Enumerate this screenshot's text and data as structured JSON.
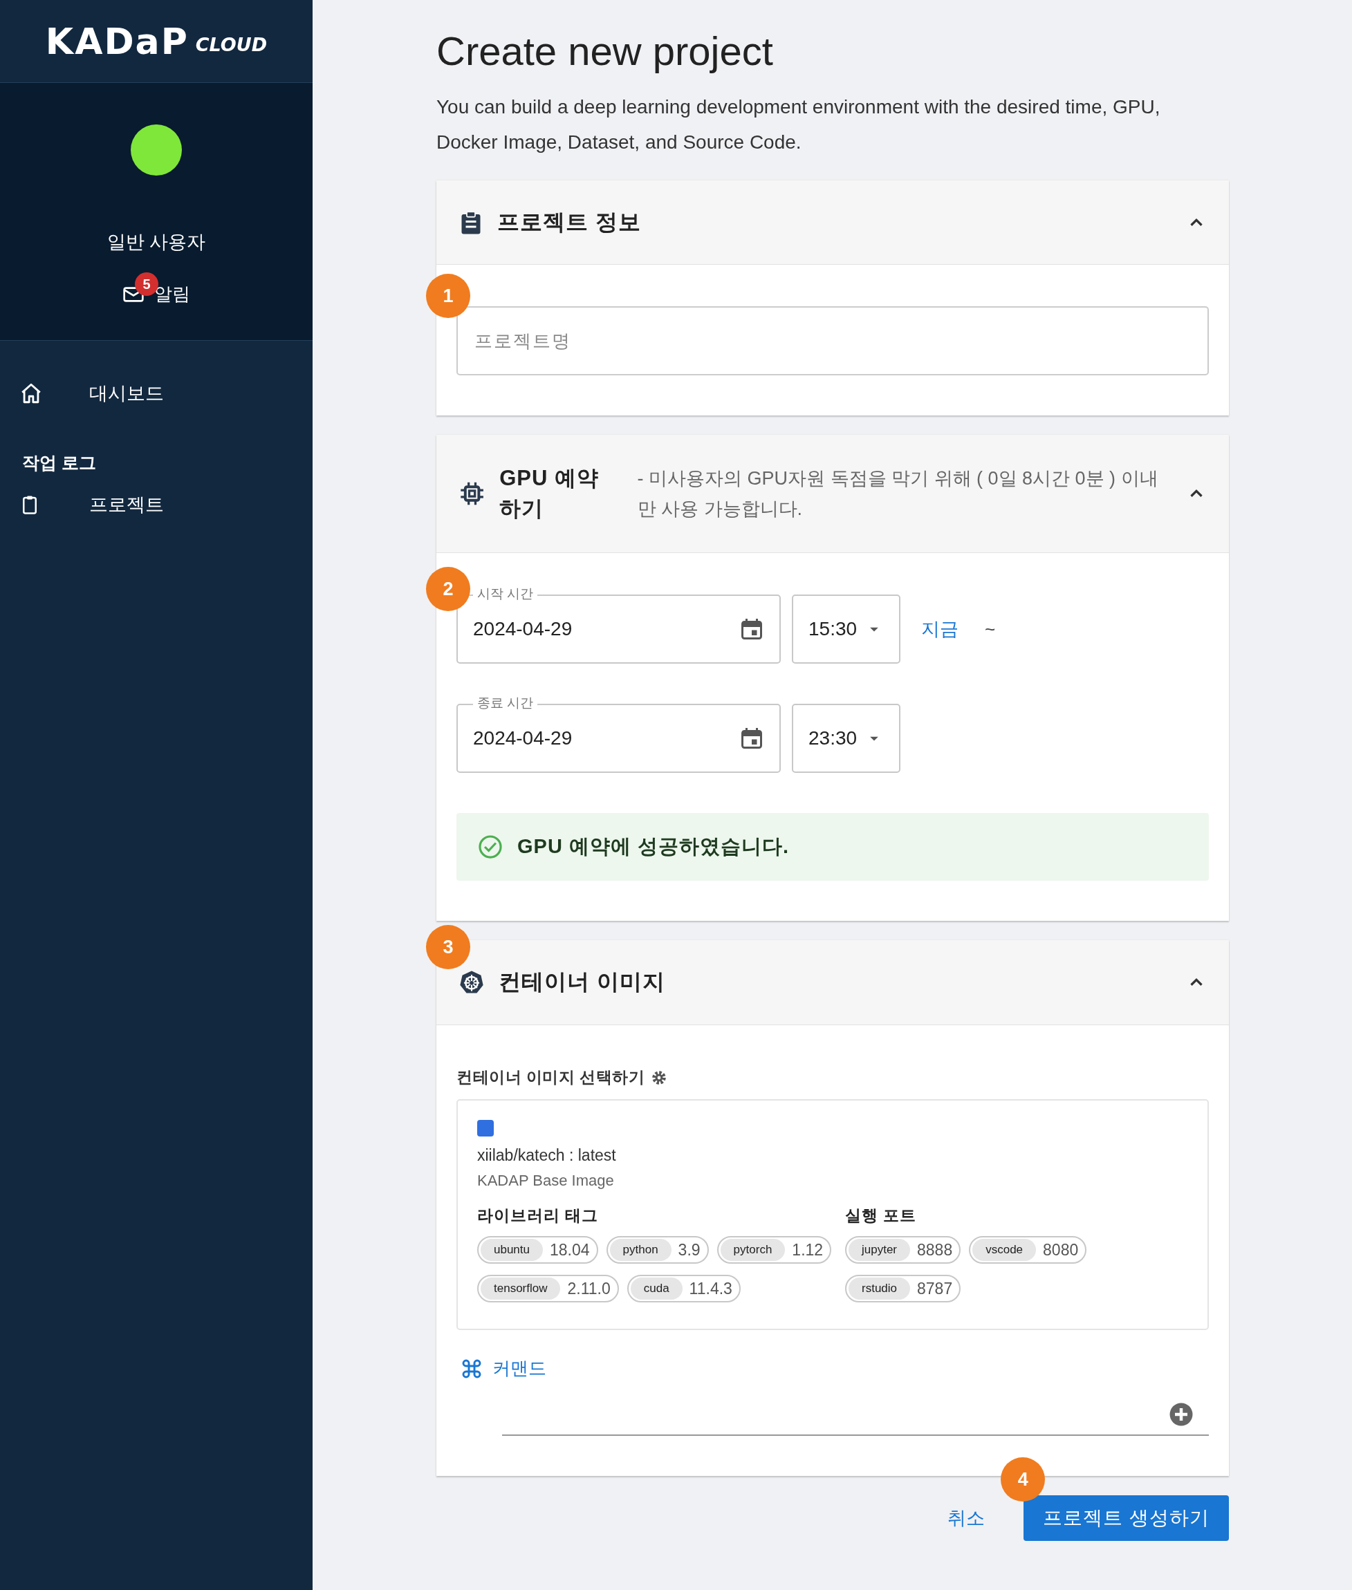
{
  "sidebar": {
    "logo": "KADaP",
    "logo_suffix": "CLOUD",
    "user_name": "일반 사용자",
    "notifications": {
      "label": "알림",
      "badge": "5"
    },
    "nav": [
      {
        "kind": "item",
        "label": "대시보드"
      },
      {
        "kind": "heading",
        "label": "작업 로그"
      },
      {
        "kind": "item",
        "label": "프로젝트"
      }
    ]
  },
  "page": {
    "title": "Create new project",
    "description": "You can build a deep learning development environment with the desired time, GPU, Docker Image, Dataset, and Source Code."
  },
  "project_info": {
    "marker": "1",
    "title": "프로젝트 정보",
    "expanded": true,
    "name_field": {
      "placeholder": "프로젝트명"
    }
  },
  "gpu_reservation": {
    "marker": "2",
    "title": "GPU 예약하기",
    "note": "- 미사용자의 GPU자원 독점을 막기 위해 ( 0일 8시간 0분 ) 이내 만 사용 가능합니다.",
    "expanded": true,
    "start": {
      "label": "시작 시간",
      "date": "2024-04-29",
      "time": "15:30"
    },
    "now_link": "지금",
    "range_separator": "~",
    "end": {
      "label": "종료 시간",
      "date": "2024-04-29",
      "time": "23:30"
    },
    "success_message": "GPU 예약에 성공하였습니다."
  },
  "container_image": {
    "marker": "3",
    "title": "컨테이너 이미지",
    "expanded": true,
    "select_label": "컨테이너 이미지 선택하기",
    "image": {
      "selected": true,
      "name": "xiilab/katech : latest",
      "description": "KADAP Base Image",
      "tags_heading": "라이브러리 태그",
      "ports_heading": "실행 포트",
      "tags": [
        {
          "name": "ubuntu",
          "value": "18.04"
        },
        {
          "name": "python",
          "value": "3.9"
        },
        {
          "name": "pytorch",
          "value": "1.12"
        },
        {
          "name": "tensorflow",
          "value": "2.11.0"
        },
        {
          "name": "cuda",
          "value": "11.4.3"
        }
      ],
      "ports": [
        {
          "name": "jupyter",
          "value": "8888"
        },
        {
          "name": "vscode",
          "value": "8080"
        },
        {
          "name": "rstudio",
          "value": "8787"
        }
      ]
    },
    "command_label": "커맨드"
  },
  "actions": {
    "cancel": "취소",
    "submit": "프로젝트 생성하기",
    "marker": "4"
  }
}
